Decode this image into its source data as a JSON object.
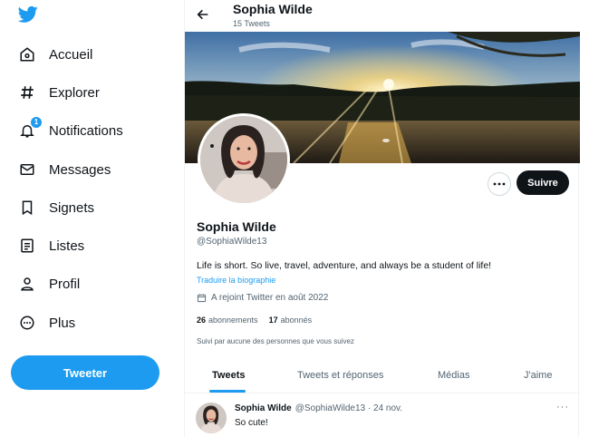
{
  "colors": {
    "accent": "#1d9bf0",
    "dark": "#0f1419",
    "muted": "#536471"
  },
  "sidebar": {
    "logo_icon": "twitter-bird-icon",
    "items": [
      {
        "label": "Accueil",
        "icon": "home-icon"
      },
      {
        "label": "Explorer",
        "icon": "hashtag-icon"
      },
      {
        "label": "Notifications",
        "icon": "bell-icon",
        "badge": "1"
      },
      {
        "label": "Messages",
        "icon": "envelope-icon"
      },
      {
        "label": "Signets",
        "icon": "bookmark-icon"
      },
      {
        "label": "Listes",
        "icon": "list-icon"
      },
      {
        "label": "Profil",
        "icon": "person-icon"
      },
      {
        "label": "Plus",
        "icon": "more-circle-icon"
      }
    ],
    "tweet_button": "Tweeter"
  },
  "header": {
    "name": "Sophia Wilde",
    "tweet_count": "15 Tweets"
  },
  "profile": {
    "name": "Sophia Wilde",
    "handle": "@SophiaWilde13",
    "bio": "Life is short. So live, travel, adventure, and always be a student of life!",
    "translate": "Traduire la biographie",
    "joined": "A rejoint Twitter en août 2022",
    "following_count": "26",
    "following_label": "abonnements",
    "followers_count": "17",
    "followers_label": "abonnés",
    "followed_by": "Suivi par aucune des personnes que vous suivez",
    "follow_button": "Suivre"
  },
  "tabs": [
    {
      "label": "Tweets",
      "active": true
    },
    {
      "label": "Tweets et réponses",
      "active": false
    },
    {
      "label": "Médias",
      "active": false
    },
    {
      "label": "J'aime",
      "active": false
    }
  ],
  "tweet": {
    "name": "Sophia Wilde",
    "meta": "@SophiaWilde13 · 24 nov.",
    "text": "So cute!",
    "more": "···"
  }
}
